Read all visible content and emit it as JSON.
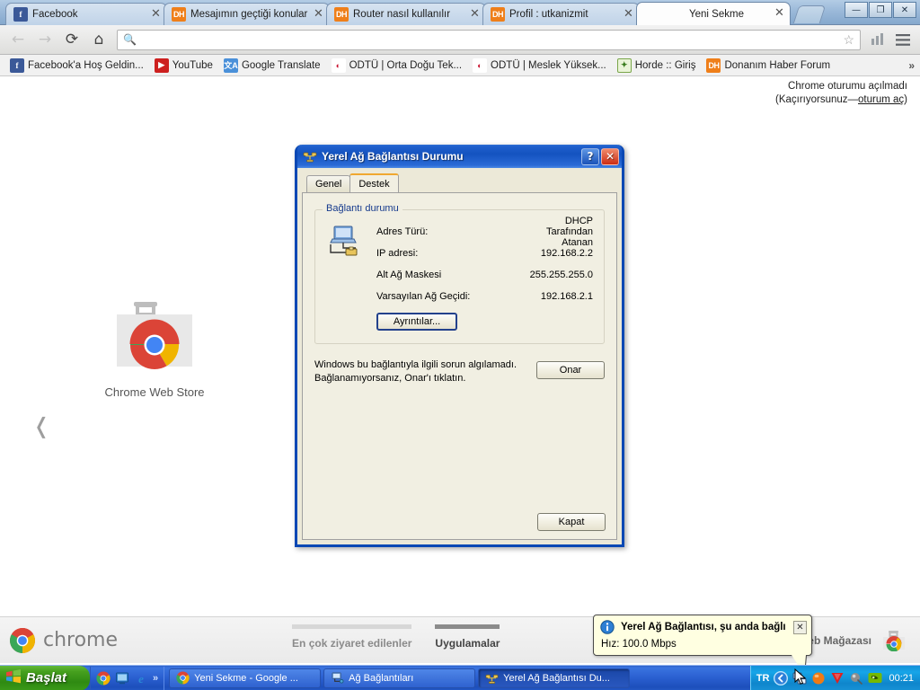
{
  "browser": {
    "tabs": [
      {
        "title": "Facebook",
        "favicon": "facebook-icon",
        "active": false
      },
      {
        "title": "Mesajımın geçtiği konular",
        "favicon": "donanimhaber-icon",
        "active": false
      },
      {
        "title": "Router nasıl kullanılır",
        "favicon": "donanimhaber-icon",
        "active": false
      },
      {
        "title": "Profil : utkanizmit",
        "favicon": "donanimhaber-icon",
        "active": false
      },
      {
        "title": "Yeni Sekme",
        "favicon": "none",
        "active": true
      }
    ],
    "close_glyph": "✕",
    "window_controls": {
      "minimize": "—",
      "maximize": "❐",
      "close": "✕"
    },
    "nav": {
      "back": "←",
      "forward": "→",
      "reload": "⟳",
      "home": "⌂"
    },
    "omnibox": {
      "value": "",
      "placeholder": "",
      "search_icon": "search-icon",
      "star_icon": "☆"
    },
    "toolbar_icons": {
      "extension": "bar-chart-icon",
      "menu": "☰"
    },
    "bookmarks": [
      {
        "label": "Facebook'a Hoş Geldin...",
        "icon": "facebook-icon",
        "icon_text": "f"
      },
      {
        "label": "YouTube",
        "icon": "youtube-icon",
        "icon_text": "▶"
      },
      {
        "label": "Google Translate",
        "icon": "google-translate-icon",
        "icon_text": "文A"
      },
      {
        "label": "ODTÜ | Orta Doğu Tek...",
        "icon": "odtu-icon",
        "icon_text": "◐"
      },
      {
        "label": "ODTÜ | Meslek Yüksek...",
        "icon": "odtu-icon",
        "icon_text": "◐"
      },
      {
        "label": "Horde :: Giriş",
        "icon": "horde-icon",
        "icon_text": "✦"
      },
      {
        "label": "Donanım Haber Forum",
        "icon": "donanimhaber-icon",
        "icon_text": "DH"
      }
    ],
    "bookmark_overflow": "»"
  },
  "newtab": {
    "sync_line1": "Chrome oturumu açılmadı",
    "sync_line2_prefix": "(Kaçırıyorsunuz—",
    "sync_link": "oturum aç",
    "sync_line2_suffix": ")",
    "tile_label": "Chrome Web Store",
    "prev_arrow": "❬",
    "brand": "chrome",
    "section_most_visited": "En çok ziyaret edilenler",
    "section_apps": "Uygulamalar",
    "store_label": "Web Mağazası"
  },
  "dialog": {
    "title": "Yerel Ağ Bağlantısı Durumu",
    "title_icon": "network-connection-icon",
    "help_button": "?",
    "close_button": "✕",
    "tabs": [
      {
        "label": "Genel",
        "selected": false
      },
      {
        "label": "Destek",
        "selected": true
      }
    ],
    "group_title": "Bağlantı durumu",
    "icon": "computer-network-icon",
    "rows": [
      {
        "key": "Adres Türü:",
        "value": "DHCP Tarafından Atanan"
      },
      {
        "key": "IP adresi:",
        "value": "192.168.2.2"
      },
      {
        "key": "Alt Ağ Maskesi",
        "value": "255.255.255.0"
      },
      {
        "key": "Varsayılan Ağ Geçidi:",
        "value": "192.168.2.1"
      }
    ],
    "details_button": "Ayrıntılar...",
    "repair_text_line1": "Windows bu bağlantıyla ilgili sorun algılamadı.",
    "repair_text_line2": "Bağlanamıyorsanız, Onar'ı tıklatın.",
    "repair_button": "Onar",
    "close_footer_button": "Kapat"
  },
  "balloon": {
    "icon": "info-icon",
    "title": "Yerel Ağ Bağlantısı, şu anda bağlı",
    "body": "Hız: 100.0 Mbps",
    "close": "✕"
  },
  "taskbar": {
    "start_label": "Başlat",
    "start_icon": "windows-flag-icon",
    "quicklaunch": [
      {
        "icon": "chrome-icon"
      },
      {
        "icon": "show-desktop-icon"
      },
      {
        "icon": "internet-explorer-icon"
      }
    ],
    "quicklaunch_more": "»",
    "tasks": [
      {
        "label": "Yeni Sekme - Google ...",
        "icon": "chrome-icon",
        "pressed": false
      },
      {
        "label": "Ağ Bağlantıları",
        "icon": "network-folder-icon",
        "pressed": false
      },
      {
        "label": "Yerel Ağ Bağlantısı Du...",
        "icon": "network-connection-icon",
        "pressed": true
      }
    ],
    "language": "TR",
    "tray_expand": "❮",
    "tray_icons": [
      {
        "icon": "network-activity-icon"
      },
      {
        "icon": "orange-ball-icon"
      },
      {
        "icon": "v-red-icon"
      },
      {
        "icon": "volume-icon"
      },
      {
        "icon": "nvidia-icon"
      }
    ],
    "clock": "00:21"
  },
  "colors": {
    "xp_blue": "#1453c0",
    "xp_taskbar": "#2a5fd0",
    "xp_start_green": "#47a11f",
    "dialog_face": "#ece9d8",
    "panel_face": "#f1efe2",
    "group_title": "#14398c",
    "tab_accent": "#f0a830",
    "balloon_bg": "#ffffe1"
  }
}
